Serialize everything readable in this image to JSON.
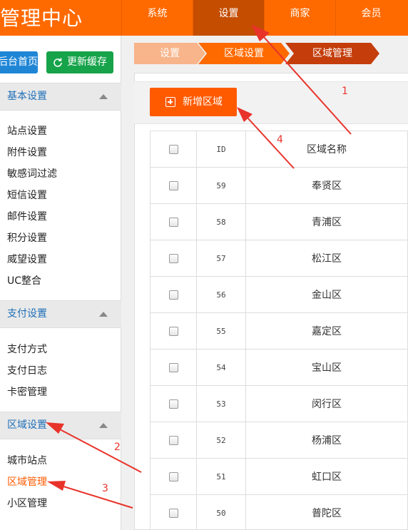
{
  "header": {
    "logo": "管理中心",
    "nav": [
      {
        "label": "系统",
        "active": false
      },
      {
        "label": "设置",
        "active": true
      },
      {
        "label": "商家",
        "active": false
      },
      {
        "label": "会员",
        "active": false
      }
    ]
  },
  "sidebar": {
    "home_button": "后台首页",
    "cache_button": "更新缓存",
    "sections": [
      {
        "title": "基本设置",
        "items": [
          "站点设置",
          "附件设置",
          "敏感词过滤",
          "短信设置",
          "邮件设置",
          "积分设置",
          "威望设置",
          "UC整合"
        ]
      },
      {
        "title": "支付设置",
        "items": [
          "支付方式",
          "支付日志",
          "卡密管理"
        ]
      },
      {
        "title": "区域设置",
        "items": [
          "城市站点",
          "区域管理",
          "小区管理"
        ],
        "active_item": "区域管理"
      }
    ]
  },
  "breadcrumb": [
    "设置",
    "区域设置",
    "区域管理"
  ],
  "toolbar": {
    "add_button": "新增区域"
  },
  "table": {
    "headers": {
      "id": "ID",
      "name": "区域名称"
    },
    "rows": [
      {
        "id": "59",
        "name": "奉贤区"
      },
      {
        "id": "58",
        "name": "青浦区"
      },
      {
        "id": "57",
        "name": "松江区"
      },
      {
        "id": "56",
        "name": "金山区"
      },
      {
        "id": "55",
        "name": "嘉定区"
      },
      {
        "id": "54",
        "name": "宝山区"
      },
      {
        "id": "53",
        "name": "闵行区"
      },
      {
        "id": "52",
        "name": "杨浦区"
      },
      {
        "id": "51",
        "name": "虹口区"
      },
      {
        "id": "50",
        "name": "普陀区"
      }
    ]
  },
  "annotations": [
    "1",
    "2",
    "3",
    "4"
  ],
  "colors": {
    "accent": "#ff6a00",
    "annotation": "#e8332b",
    "link": "#1f6fb8"
  }
}
